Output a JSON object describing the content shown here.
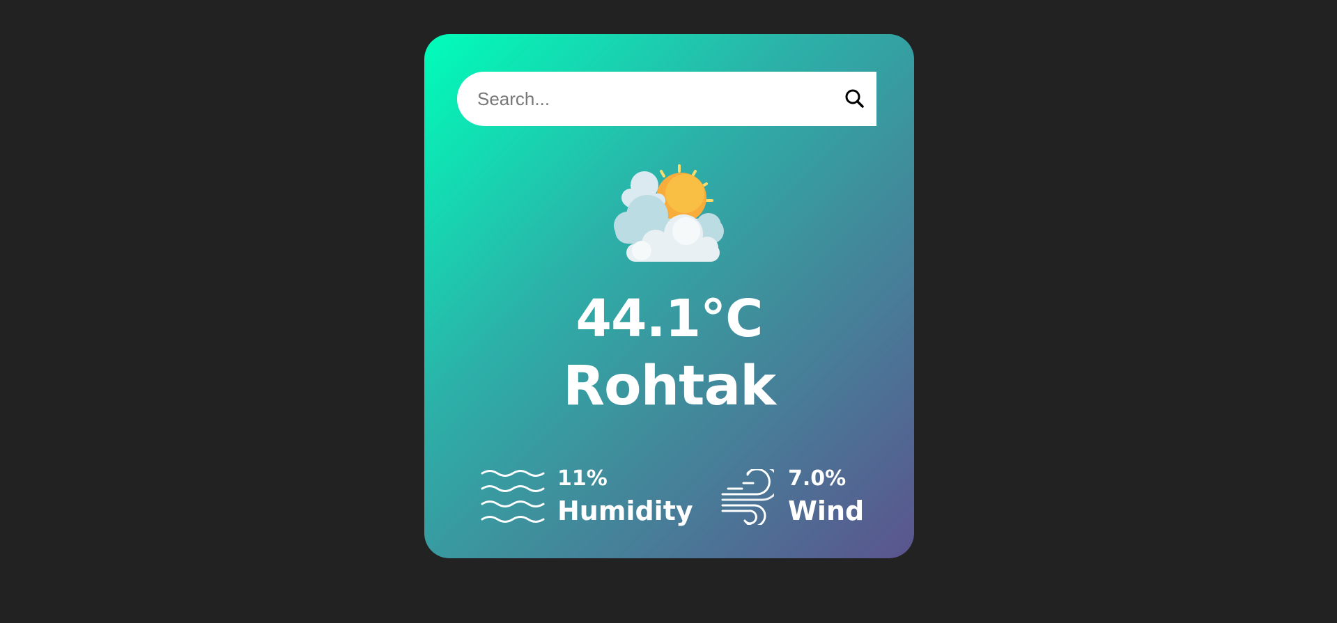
{
  "search": {
    "placeholder": "Search...",
    "value": ""
  },
  "weather": {
    "condition_icon": "partly-cloudy-icon",
    "temperature": "44.1°C",
    "city": "Rohtak"
  },
  "details": {
    "humidity": {
      "value": "11%",
      "label": "Humidity",
      "icon": "humidity-waves-icon"
    },
    "wind": {
      "value": "7.0%",
      "label": "Wind",
      "icon": "wind-icon"
    }
  },
  "colors": {
    "background": "#222222",
    "card_gradient_start": "#00feba",
    "card_gradient_end": "#5b548e",
    "text": "#ffffff"
  }
}
